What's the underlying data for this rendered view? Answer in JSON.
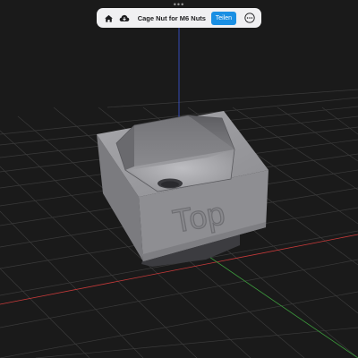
{
  "toolbar": {
    "home_icon": "home-icon",
    "cloud_icon": "cloud-download-icon",
    "title": "Cage Nut for M6 Nuts",
    "share_label": "Teilen",
    "more_icon": "ellipsis-circle-icon"
  },
  "model": {
    "engraving": "Top"
  },
  "colors": {
    "background": "#1a1a1a",
    "accent": "#1a8fe3",
    "model_gray": "#909094",
    "x_axis": "#c83a3a",
    "y_axis": "#3c9a3c",
    "z_axis": "#3b59e0"
  }
}
